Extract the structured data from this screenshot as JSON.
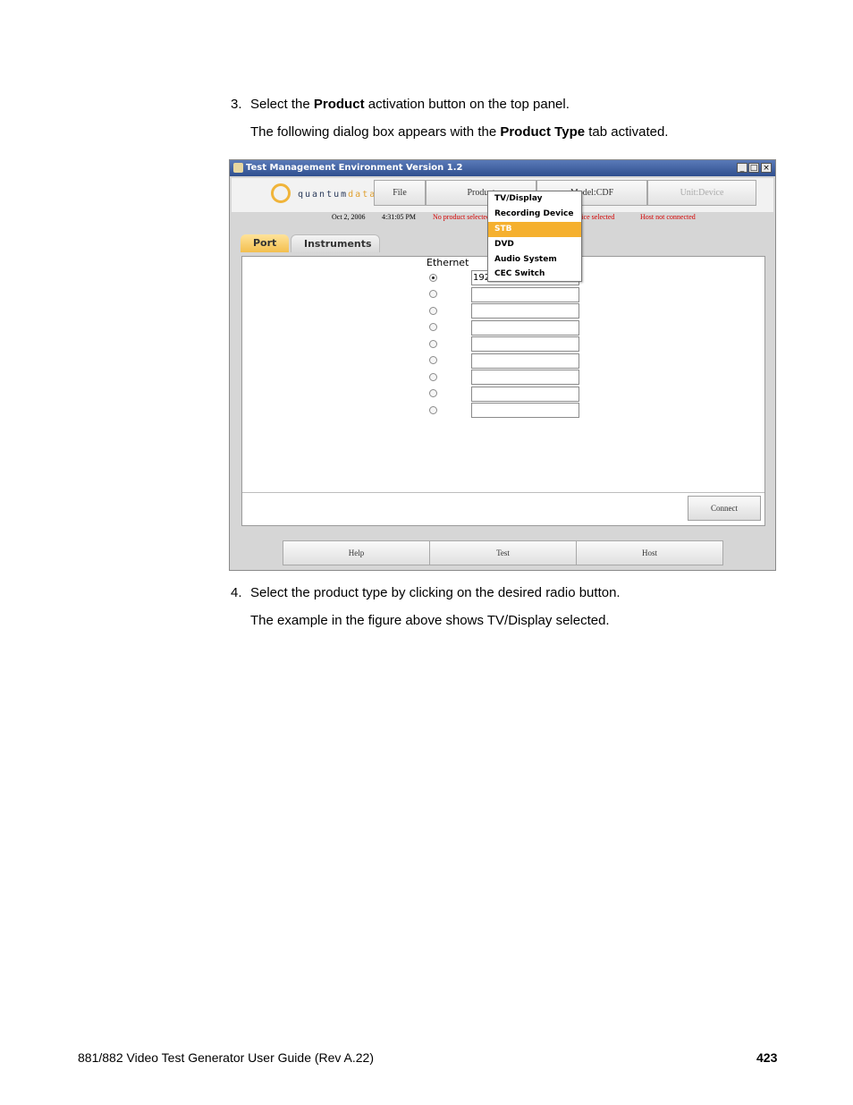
{
  "steps": {
    "step3": {
      "number": "3.",
      "pre": "Select the ",
      "bold": "Product",
      "post": " activation button on the top panel.",
      "sub_pre": "The following dialog box appears with the ",
      "sub_bold": "Product Type",
      "sub_post": " tab activated."
    },
    "step4": {
      "number": "4.",
      "text": "Select the product type by clicking on the desired radio button.",
      "sub": "The example in the figure above shows TV/Display selected."
    }
  },
  "window": {
    "title": "Test Management Environment Version 1.2",
    "controls": {
      "minimize": "_",
      "maximize": "□",
      "close": "×"
    },
    "logo": {
      "pre": "quantum",
      "accent": "data"
    },
    "top_buttons": {
      "file": "File",
      "product": "Product",
      "model": "Model:CDF",
      "unit": "Unit:Device"
    },
    "status": {
      "date": "Oct 2, 2006",
      "time": "4:31:05 PM",
      "product": "No product selected",
      "device": "No device selected",
      "host": "Host not connected"
    },
    "tabs": {
      "port": "Port",
      "instruments": "Instruments"
    },
    "ethernet_label": "Ethernet",
    "fields": [
      "192",
      "",
      "",
      "",
      "",
      "",
      "",
      "",
      ""
    ],
    "connect": "Connect",
    "bottom_buttons": {
      "help": "Help",
      "test": "Test",
      "host": "Host"
    },
    "menu": [
      "TV/Display",
      "Recording Device",
      "STB",
      "DVD",
      "Audio System",
      "CEC Switch"
    ]
  },
  "footer": {
    "title": "881/882 Video Test Generator User Guide (Rev A.22)",
    "page": "423"
  }
}
